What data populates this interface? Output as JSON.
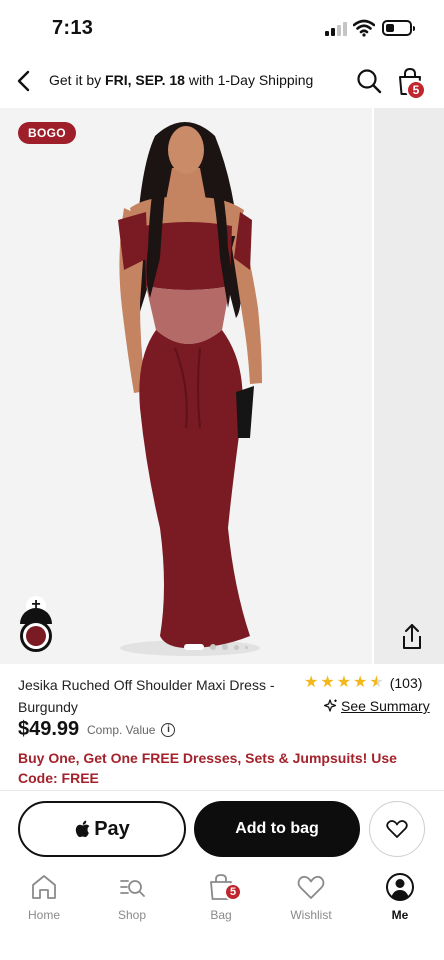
{
  "status_bar": {
    "time": "7:13"
  },
  "header": {
    "shipping_prefix": "Get it by ",
    "shipping_date": "FRI, SEP. 18",
    "shipping_suffix": " with 1-Day Shipping",
    "bag_count": "5"
  },
  "gallery": {
    "badge": "BOGO",
    "slide_count": 5,
    "active_slide": 1,
    "swatch_color": "#7a1a22"
  },
  "product": {
    "name": "Jesika Ruched Off Shoulder Maxi Dress - Burgundy",
    "rating_stars": 4.5,
    "rating_count": "(103)",
    "see_summary": "See Summary",
    "price": "$49.99",
    "comp_value_label": "Comp. Value",
    "promo": "Buy One, Get One FREE Dresses, Sets & Jumpsuits! Use Code: FREE"
  },
  "actions": {
    "apple_pay_label": "Pay",
    "add_to_bag_label": "Add to bag"
  },
  "tab_bar": {
    "items": [
      {
        "label": "Home",
        "icon": "home-icon"
      },
      {
        "label": "Shop",
        "icon": "shop-icon"
      },
      {
        "label": "Bag",
        "icon": "bag-icon",
        "badge": "5"
      },
      {
        "label": "Wishlist",
        "icon": "heart-icon"
      },
      {
        "label": "Me",
        "icon": "profile-icon",
        "active": true
      }
    ]
  },
  "colors": {
    "accent_red": "#c0262d",
    "promo_red": "#a3222c",
    "dress_burgundy": "#7a1a22",
    "star_gold": "#f2b81b"
  }
}
